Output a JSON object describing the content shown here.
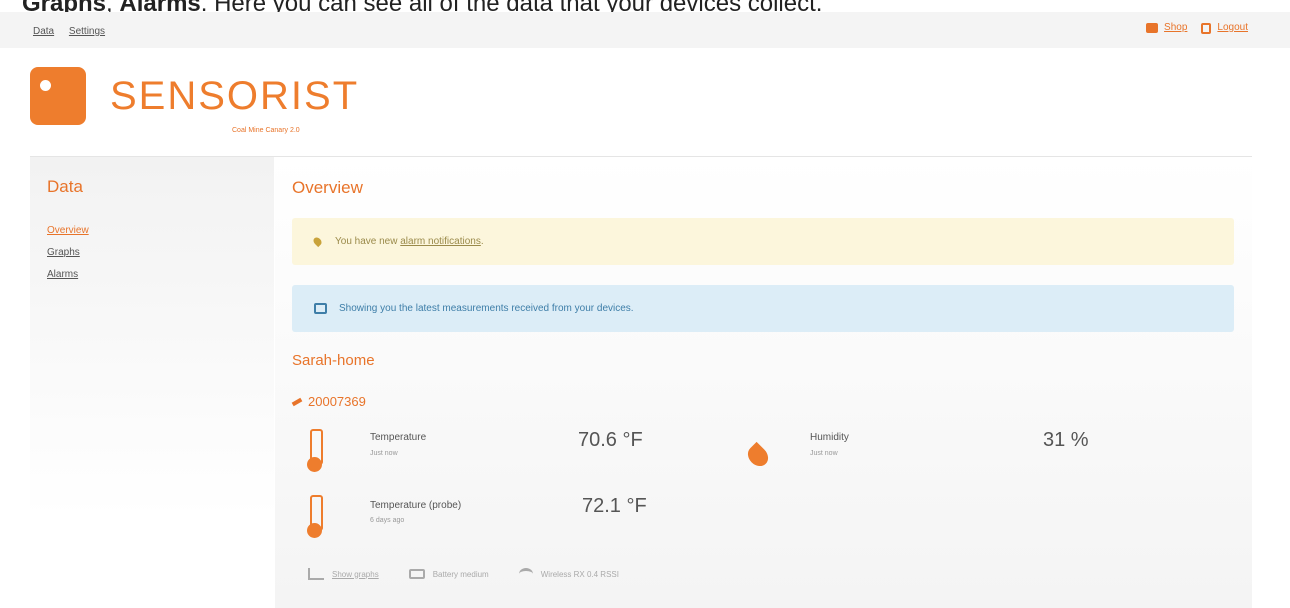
{
  "caption": {
    "part1": "Graphs",
    "sep": ", ",
    "part2": "Alarms",
    "rest": ". Here you can see all of the data that your devices collect."
  },
  "topnav": {
    "data": "Data",
    "settings": "Settings"
  },
  "toplinks": {
    "shop": "Shop",
    "logout": "Logout"
  },
  "brand": {
    "name": "SENSORIST",
    "tagline": "Coal Mine Canary 2.0"
  },
  "sidebar": {
    "title": "Data",
    "items": [
      {
        "label": "Overview"
      },
      {
        "label": "Graphs"
      },
      {
        "label": "Alarms"
      }
    ]
  },
  "main": {
    "title": "Overview",
    "alert_warn": {
      "prefix": "You have new ",
      "link": "alarm notifications",
      "suffix": "."
    },
    "alert_info": "Showing you the latest measurements received from your devices.",
    "device": {
      "name": "Sarah-home",
      "id": "20007369",
      "sensors": [
        {
          "label": "Temperature",
          "sub": "Just now",
          "value": "70.6 °F"
        },
        {
          "label": "Humidity",
          "sub": "Just now",
          "value": "31 %"
        },
        {
          "label": "Temperature (probe)",
          "sub": "6 days ago",
          "value": "72.1 °F"
        }
      ],
      "footer": {
        "graphs": "Show graphs",
        "battery": "Battery medium",
        "wireless": "Wireless RX 0.4 RSSI"
      }
    }
  }
}
